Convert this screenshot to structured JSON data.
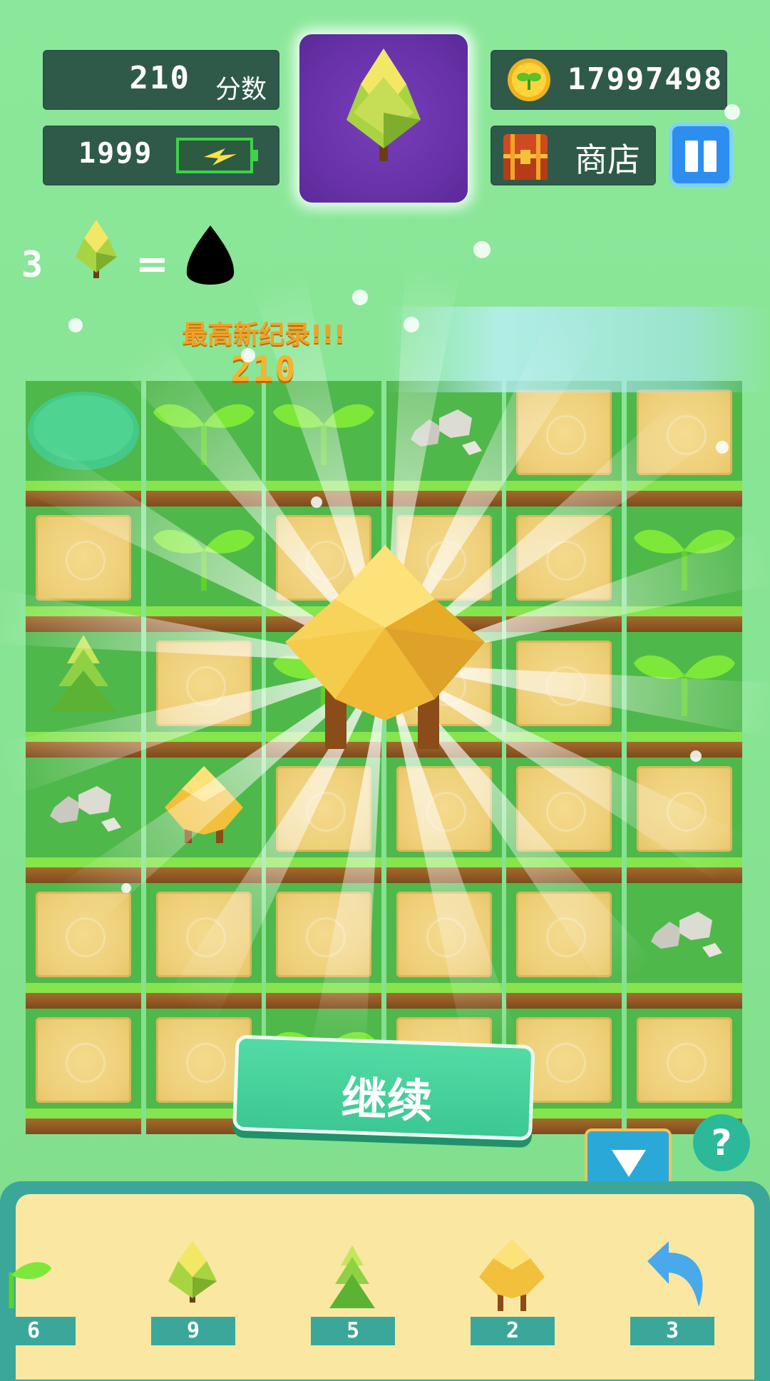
{
  "hud": {
    "score_value": "210",
    "score_label": "分数",
    "energy_value": "1999",
    "coins_value": "17997498",
    "shop_label": "商店"
  },
  "recipe": {
    "count": "3",
    "equals": "="
  },
  "record": {
    "title": "最高新纪录!!!",
    "value": "210"
  },
  "grid": {
    "rows": [
      [
        "pond",
        "sprout",
        "sprout",
        "rocks",
        "empty",
        "empty"
      ],
      [
        "empty",
        "sprout",
        "empty",
        "empty",
        "empty",
        "sprout"
      ],
      [
        "pine",
        "empty",
        "sprout",
        "empty",
        "empty",
        "sprout"
      ],
      [
        "rocks",
        "golden-tree-small",
        "empty",
        "empty",
        "empty",
        "empty"
      ],
      [
        "empty",
        "empty",
        "empty",
        "empty",
        "empty",
        "rocks"
      ],
      [
        "empty",
        "empty",
        "sprout",
        "empty",
        "empty",
        "empty"
      ]
    ]
  },
  "continue_label": "继续",
  "help_label": "?",
  "tray": {
    "items": [
      {
        "icon": "sprout",
        "count": "6"
      },
      {
        "icon": "yellow-bush",
        "count": "9"
      },
      {
        "icon": "pine",
        "count": "5"
      },
      {
        "icon": "golden-tree",
        "count": "2"
      },
      {
        "icon": "undo-arrow",
        "count": "3"
      }
    ]
  },
  "colors": {
    "accent": "#3cc893",
    "panel": "#2f5a4a",
    "record": "#f2a12a"
  }
}
